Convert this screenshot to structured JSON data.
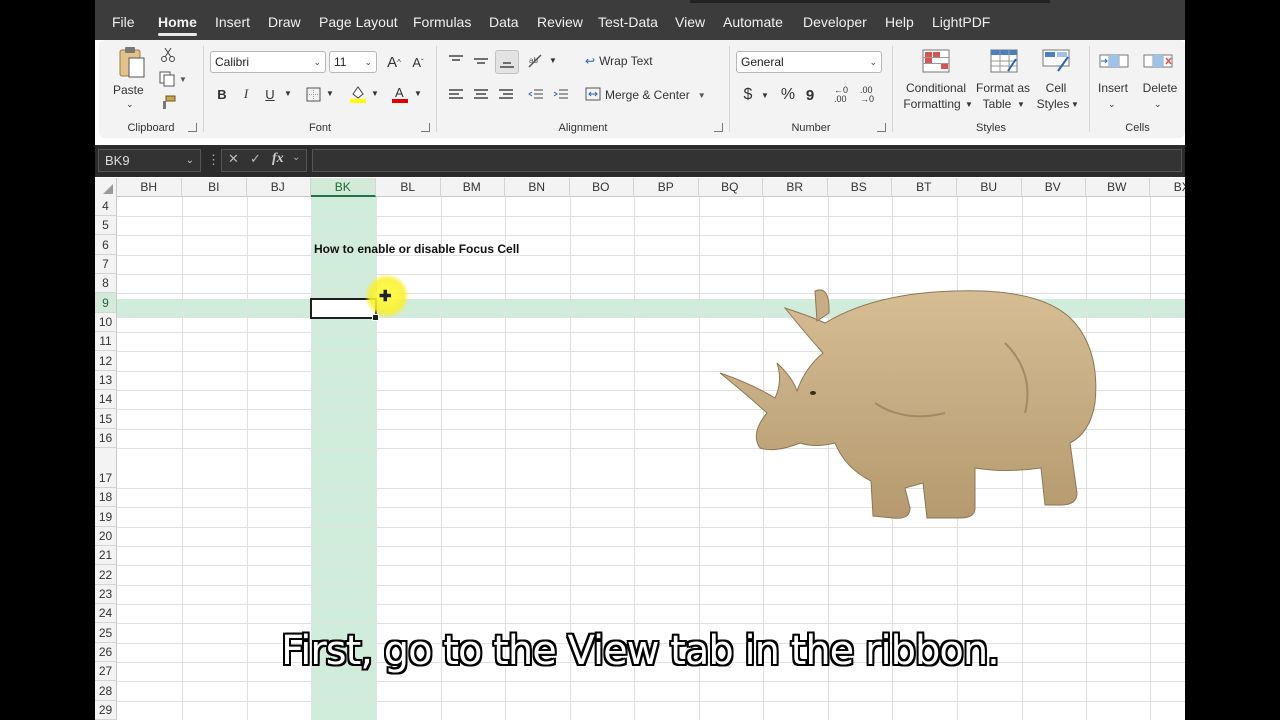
{
  "menu": {
    "tabs": [
      "File",
      "Home",
      "Insert",
      "Draw",
      "Page Layout",
      "Formulas",
      "Data",
      "Review",
      "Test-Data",
      "View",
      "Automate",
      "Developer",
      "Help",
      "LightPDF"
    ],
    "active": "Home"
  },
  "ribbon": {
    "clipboard": {
      "label": "Clipboard",
      "paste_label": "Paste"
    },
    "font": {
      "label": "Font",
      "font_name": "Calibri",
      "font_size": "11",
      "bold": "B",
      "italic": "I",
      "underline": "U",
      "fill_color": "#ffff00",
      "font_color": "#e00000"
    },
    "alignment": {
      "label": "Alignment",
      "wrap_text": "Wrap Text",
      "merge_center": "Merge & Center"
    },
    "number": {
      "label": "Number",
      "format": "General",
      "currency": "$",
      "percent": "%",
      "comma": "9"
    },
    "styles": {
      "label": "Styles",
      "conditional_1": "Conditional",
      "conditional_2": "Formatting",
      "format_table_1": "Format as",
      "format_table_2": "Table",
      "cell_styles_1": "Cell",
      "cell_styles_2": "Styles"
    },
    "cells": {
      "label": "Cells",
      "insert": "Insert",
      "delete": "Delete"
    }
  },
  "formula_bar": {
    "name_box": "BK9",
    "fx": "fx",
    "formula": ""
  },
  "sheet": {
    "columns": [
      "BH",
      "BI",
      "BJ",
      "BK",
      "BL",
      "BM",
      "BN",
      "BO",
      "BP",
      "BQ",
      "BR",
      "BS",
      "BT",
      "BU",
      "BV",
      "BW",
      "BX"
    ],
    "selected_column": "BK",
    "rows": [
      "4",
      "5",
      "6",
      "7",
      "8",
      "9",
      "10",
      "11",
      "12",
      "13",
      "14",
      "15",
      "16",
      "17",
      "18",
      "19",
      "20",
      "21",
      "22",
      "23",
      "24",
      "25",
      "26",
      "27",
      "28",
      "29"
    ],
    "selected_row": "9",
    "cell_bk6_text": "How to enable or disable Focus Cell",
    "focus_cell_color": "#d3ead9"
  },
  "subtitle": "First, go to the View tab in the ribbon."
}
